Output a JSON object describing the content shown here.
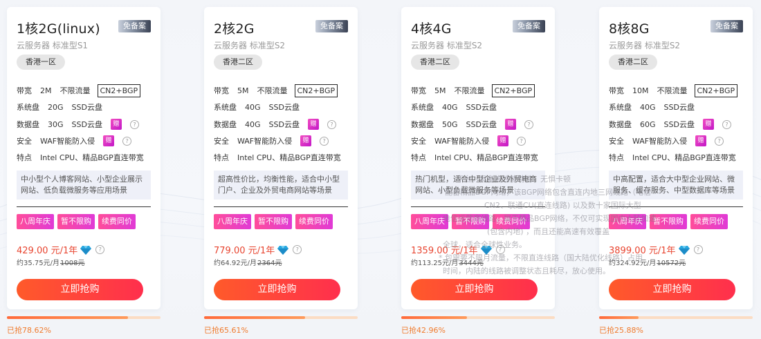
{
  "cards": [
    {
      "title": "1核2G(linux)",
      "badge": "免备案",
      "subtitle": "云服务器 标准型S1",
      "region": "香港一区",
      "specs": {
        "bandwidth_label": "带宽",
        "bandwidth_value": "2M",
        "bandwidth_extra": "不限流量",
        "bandwidth_tag": "CN2+BGP",
        "sysdisk_label": "系统盘",
        "sysdisk_value": "20G",
        "sysdisk_type": "SSD云盘",
        "datadisk_label": "数据盘",
        "datadisk_value": "30G",
        "datadisk_type": "SSD云盘",
        "gift": "赠",
        "security_label": "安全",
        "security_value": "WAF智能防入侵",
        "feature_label": "特点",
        "feature_value": "Intel CPU、精品BGP直连带宽"
      },
      "description": "中小型个人博客网站、小型企业展示网站、低负载微服务等应用场景",
      "tags": [
        "八周年庆",
        "暂不限购",
        "续费同价"
      ],
      "price": "429.00 元/1年",
      "monthly": "约35.75元/月",
      "original": "1008元",
      "buy_label": "立即抢购",
      "progress_label": "已抢78.62%",
      "progress_value": 78.62
    },
    {
      "title": "2核2G",
      "badge": "免备案",
      "subtitle": "云服务器 标准型S2",
      "region": "香港二区",
      "specs": {
        "bandwidth_label": "带宽",
        "bandwidth_value": "5M",
        "bandwidth_extra": "不限流量",
        "bandwidth_tag": "CN2+BGP",
        "sysdisk_label": "系统盘",
        "sysdisk_value": "40G",
        "sysdisk_type": "SSD云盘",
        "datadisk_label": "数据盘",
        "datadisk_value": "40G",
        "datadisk_type": "SSD云盘",
        "gift": "赠",
        "security_label": "安全",
        "security_value": "WAF智能防入侵",
        "feature_label": "特点",
        "feature_value": "Intel CPU、精品BGP直连带宽"
      },
      "description": "超高性价比，均衡性能，适合中小型门户、企业及外贸电商网站等场景",
      "tags": [
        "八周年庆",
        "暂不限购",
        "续费同价"
      ],
      "price": "779.00 元/1年",
      "monthly": "约64.92元/月",
      "original": "2364元",
      "buy_label": "立即抢购",
      "progress_label": "已抢65.61%",
      "progress_value": 65.61
    },
    {
      "title": "4核4G",
      "badge": "免备案",
      "subtitle": "云服务器 标准型S2",
      "region": "香港二区",
      "specs": {
        "bandwidth_label": "带宽",
        "bandwidth_value": "5M",
        "bandwidth_extra": "不限流量",
        "bandwidth_tag": "CN2+BGP",
        "sysdisk_label": "系统盘",
        "sysdisk_value": "40G",
        "sysdisk_type": "SSD云盘",
        "datadisk_label": "数据盘",
        "datadisk_value": "50G",
        "datadisk_type": "SSD云盘",
        "gift": "赠",
        "security_label": "安全",
        "security_value": "WAF智能防入侵",
        "feature_label": "特点",
        "feature_value": "Intel CPU、精品BGP直连带宽"
      },
      "description": "热门机型，适合中型企业及外贸电商网站、小型负载微服务等场景",
      "tags": [
        "八周年庆",
        "暂不限购",
        "续费同价"
      ],
      "price": "1359.00 元/1年",
      "monthly": "约113.25元/月",
      "original": "3444元",
      "buy_label": "立即抢购",
      "progress_label": "已抢42.96%",
      "progress_value": 42.96
    },
    {
      "title": "8核8G",
      "badge": "免备案",
      "subtitle": "云服务器 标准型S2",
      "region": "香港二区",
      "specs": {
        "bandwidth_label": "带宽",
        "bandwidth_value": "10M",
        "bandwidth_extra": "不限流量",
        "bandwidth_tag": "CN2+BGP",
        "sysdisk_label": "系统盘",
        "sysdisk_value": "40G",
        "sysdisk_type": "SSD云盘",
        "datadisk_label": "数据盘",
        "datadisk_value": "60G",
        "datadisk_type": "SSD云盘",
        "gift": "赠",
        "security_label": "安全",
        "security_value": "WAF智能防入侵",
        "feature_label": "特点",
        "feature_value": "Intel CPU、精品BGP直连带宽"
      },
      "description": "中高配置，适合大中型企业网站、微服务、缓存服务、中型数据库等场景",
      "tags": [
        "八周年庆",
        "暂不限购",
        "续费同价"
      ],
      "price": "3899.00 元/1年",
      "monthly": "约324.92元/月",
      "original": "10572元",
      "buy_label": "立即抢购",
      "progress_label": "已抢25.88%",
      "progress_value": 25.88
    }
  ],
  "tooltip": {
    "lines": [
      "平台，具备高性能特性，无惧卡顿",
      "* 配备精品BGP网络，该BGP网络包含直连内地三网线路（电信",
      "CN2、联通CU(直连线路) 以及数十家国际大型",
      "电信运营商线路，属于精品BGP网络，不仅可实现国内大陆加速",
      "(包含内地) ，而且还能高速有效覆盖",
      "全球，适合全球性业务。",
      "* 包需要不限月流量，不限直连线路（国大陆优化线路）占用",
      "时间，内陆的线路被调整状态且耗尽，放心使用。"
    ]
  },
  "colors": {
    "price": "#e8442f",
    "buy_gradient_start": "#ff5a2a",
    "buy_gradient_end": "#ff2f4d",
    "tag_gradient_start": "#ff4d9a",
    "tag_gradient_end": "#e03ad6",
    "progress": "#f07b2e"
  },
  "icons": {
    "price_icon": "diamond-icon",
    "help_icon": "question-mark-icon"
  }
}
